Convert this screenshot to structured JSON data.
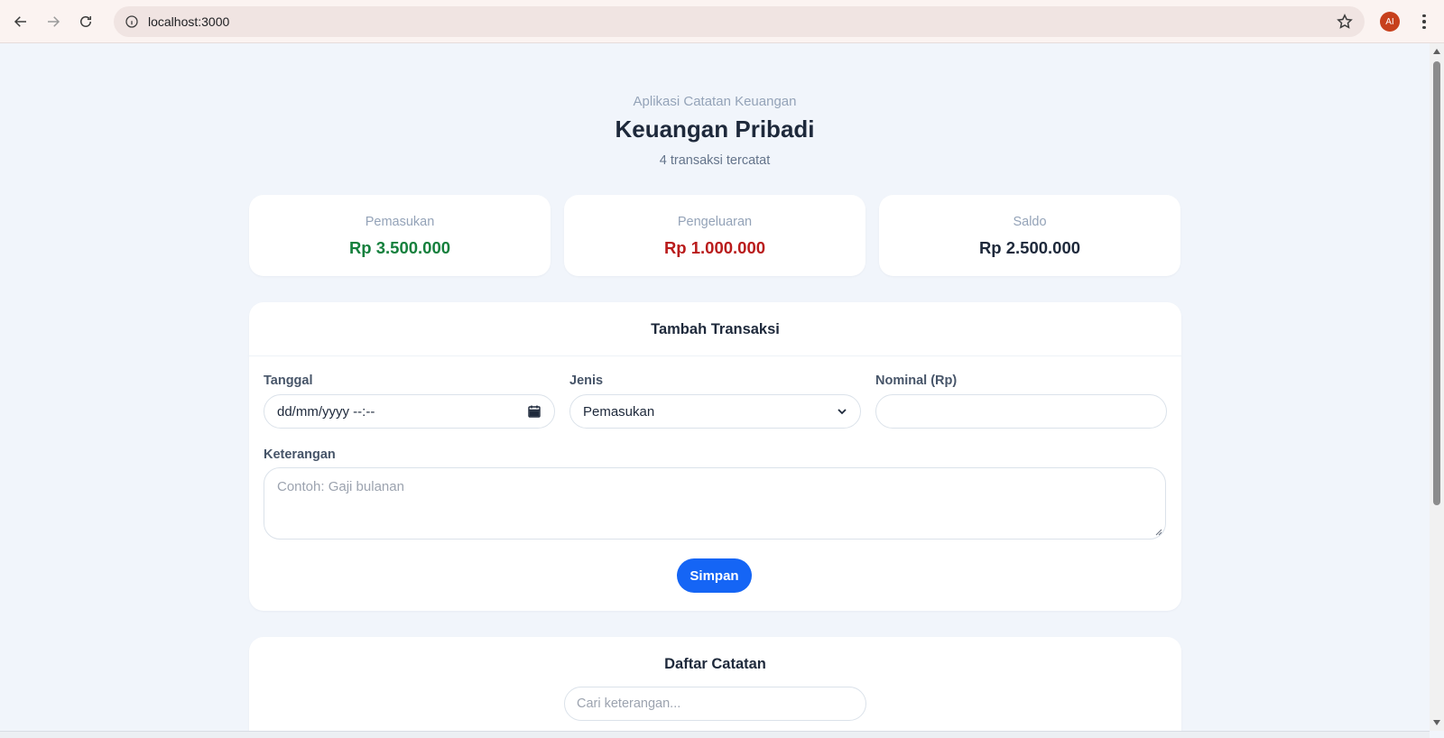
{
  "browser": {
    "url": "localhost:3000",
    "profile_initials": "AI",
    "profile_color": "#c7401c"
  },
  "page": {
    "app_subtitle": "Aplikasi Catatan Keuangan",
    "title": "Keuangan Pribadi",
    "count_text": "4 transaksi tercatat"
  },
  "summary": [
    {
      "label": "Pemasukan",
      "value": "Rp 3.500.000",
      "color": "#15803d"
    },
    {
      "label": "Pengeluaran",
      "value": "Rp 1.000.000",
      "color": "#b91c1c"
    },
    {
      "label": "Saldo",
      "value": "Rp 2.500.000",
      "color": "#1e293b"
    }
  ],
  "form": {
    "title": "Tambah Transaksi",
    "date_label": "Tanggal",
    "date_value": "dd/mm/yyyy --:--",
    "type_label": "Jenis",
    "type_value": "Pemasukan",
    "amount_label": "Nominal (Rp)",
    "amount_value": "",
    "note_label": "Keterangan",
    "note_placeholder": "Contoh: Gaji bulanan",
    "save_label": "Simpan",
    "save_color": "#1565f5"
  },
  "list": {
    "title": "Daftar Catatan",
    "search_placeholder": "Cari keterangan..."
  }
}
